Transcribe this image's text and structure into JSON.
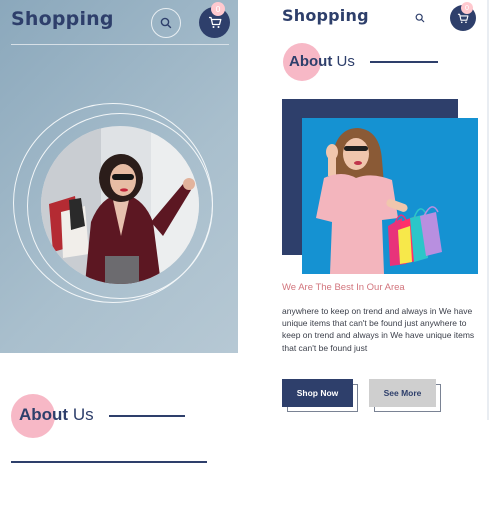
{
  "left_screen": {
    "brand": "Shopping",
    "cart_count": "0",
    "about": {
      "bold": "About",
      "rest": " Us"
    }
  },
  "right_screen": {
    "brand": "Shopping",
    "cart_count": "0",
    "about": {
      "bold": "About",
      "rest": " Us"
    },
    "subheading": "We Are The Best In Our Area",
    "paragraph": "anywhere to keep on trend and always in We have unique items that can't be found just anywhere to keep on trend and always in We have unique items that can't be found just",
    "buttons": {
      "shop_now": "Shop Now",
      "see_more": "See More"
    }
  },
  "icons": {
    "search": "search-icon",
    "cart": "cart-icon"
  },
  "colors": {
    "brand_navy": "#2e3f6b",
    "accent_pink": "#f7b8c6",
    "subheading_pink": "#d2757d",
    "hero_blue_grey": "#9fb6c5",
    "photo_blue": "#1592d2"
  }
}
